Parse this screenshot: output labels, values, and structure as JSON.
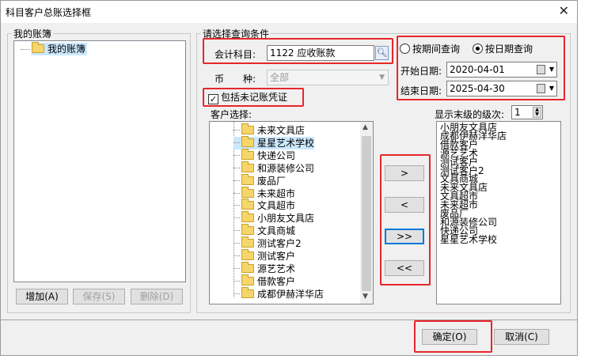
{
  "window": {
    "title": "科目客户总账选择框",
    "close_glyph": "✕"
  },
  "left": {
    "group_label": "我的账簿",
    "tree_item": "我的账簿",
    "buttons": {
      "add": "增加(A)",
      "save": "保存(S)",
      "delete": "删除(D)"
    }
  },
  "query": {
    "group_label": "请选择查询条件",
    "account_label": "会计科目:",
    "account_value": "1122 应收账款",
    "currency_label": "币　　种:",
    "currency_value": "全部",
    "include_unposted": "包括未记账凭证",
    "include_unposted_checked": true,
    "period_option": "按期间查询",
    "date_option": "按日期查询",
    "selected_option": "date",
    "start_label": "开始日期:",
    "start_value": "2020-04-01",
    "end_label": "结束日期:",
    "end_value": "2025-04-30",
    "customer_label": "客户选择:",
    "level_label": "显示末级的级次:",
    "level_value": "1"
  },
  "customers": [
    "未来文具店",
    "星星艺术学校",
    "快递公司",
    "和源装修公司",
    "废品厂",
    "未来超市",
    "文具超市",
    "小朋友文具店",
    "文具商城",
    "测试客户2",
    "测试客户",
    "源艺艺术",
    "借款客户",
    "成都伊赫洋华店"
  ],
  "selected_customer_index": 1,
  "selected_list": [
    "小朋友文具店",
    "成都伊赫洋华店",
    "借款客户",
    "源艺艺术",
    "测试客户",
    "测试客户2",
    "文具商城",
    "未来文具店",
    "文具超市",
    "未来超市",
    "废品厂",
    "和源装修公司",
    "快递公司",
    "星星艺术学校"
  ],
  "transfer": {
    "add_one": ">",
    "remove_one": "<",
    "add_all": ">>",
    "remove_all": "<<"
  },
  "footer": {
    "ok": "确定(O)",
    "cancel": "取消(C)"
  },
  "colors": {
    "highlight": "#e8262b",
    "selection": "#cce8ff"
  }
}
